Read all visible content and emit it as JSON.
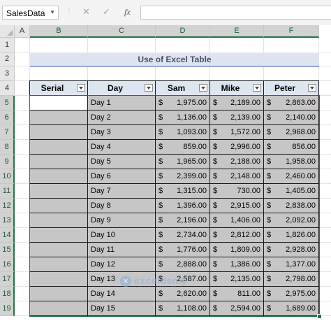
{
  "formula_bar": {
    "name_box": "SalesData",
    "formula": "",
    "fx_label": "fx"
  },
  "columns": [
    "A",
    "B",
    "C",
    "D",
    "E",
    "F"
  ],
  "rows": [
    "1",
    "2",
    "3",
    "4",
    "5",
    "6",
    "7",
    "8",
    "9",
    "10",
    "11",
    "12",
    "13",
    "14",
    "15",
    "16",
    "17",
    "18",
    "19"
  ],
  "title": "Use of Excel Table",
  "table": {
    "headers": [
      "Serial",
      "Day",
      "Sam",
      "Mike",
      "Peter"
    ],
    "currency": "$",
    "rows": [
      {
        "serial": "",
        "day": "Day 1",
        "sam": "1,975.00",
        "mike": "2,189.00",
        "peter": "2,863.00"
      },
      {
        "serial": "",
        "day": "Day 2",
        "sam": "1,136.00",
        "mike": "2,139.00",
        "peter": "2,140.00"
      },
      {
        "serial": "",
        "day": "Day 3",
        "sam": "1,093.00",
        "mike": "1,572.00",
        "peter": "2,968.00"
      },
      {
        "serial": "",
        "day": "Day 4",
        "sam": "859.00",
        "mike": "2,996.00",
        "peter": "856.00"
      },
      {
        "serial": "",
        "day": "Day 5",
        "sam": "1,965.00",
        "mike": "2,188.00",
        "peter": "1,958.00"
      },
      {
        "serial": "",
        "day": "Day 6",
        "sam": "2,399.00",
        "mike": "2,148.00",
        "peter": "2,460.00"
      },
      {
        "serial": "",
        "day": "Day 7",
        "sam": "1,315.00",
        "mike": "730.00",
        "peter": "1,405.00"
      },
      {
        "serial": "",
        "day": "Day 8",
        "sam": "1,396.00",
        "mike": "2,915.00",
        "peter": "2,838.00"
      },
      {
        "serial": "",
        "day": "Day 9",
        "sam": "2,196.00",
        "mike": "1,406.00",
        "peter": "2,092.00"
      },
      {
        "serial": "",
        "day": "Day 10",
        "sam": "2,734.00",
        "mike": "2,812.00",
        "peter": "1,826.00"
      },
      {
        "serial": "",
        "day": "Day 11",
        "sam": "1,776.00",
        "mike": "1,809.00",
        "peter": "2,928.00"
      },
      {
        "serial": "",
        "day": "Day 12",
        "sam": "2,888.00",
        "mike": "1,386.00",
        "peter": "1,377.00"
      },
      {
        "serial": "",
        "day": "Day 13",
        "sam": "2,587.00",
        "mike": "2,135.00",
        "peter": "2,798.00"
      },
      {
        "serial": "",
        "day": "Day 14",
        "sam": "2,620.00",
        "mike": "811.00",
        "peter": "2,975.00"
      },
      {
        "serial": "",
        "day": "Day 15",
        "sam": "1,108.00",
        "mike": "2,594.00",
        "peter": "1,689.00"
      }
    ]
  },
  "watermark": {
    "name": "exceldemy",
    "tagline": "EXCEL · DATA · BI"
  }
}
